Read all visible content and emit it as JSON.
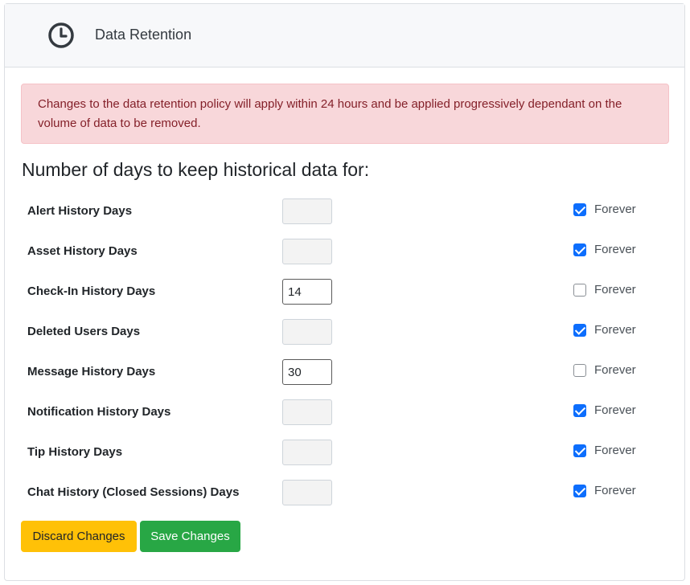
{
  "header": {
    "icon": "clock-icon",
    "title": "Data Retention"
  },
  "alert": {
    "text": "Changes to the data retention policy will apply within 24 hours and be applied progressively dependant on the volume of data to be removed."
  },
  "section": {
    "heading": "Number of days to keep historical data for:"
  },
  "settings": [
    {
      "label": "Alert History Days",
      "value": "",
      "forever": true,
      "forever_label": "Forever"
    },
    {
      "label": "Asset History Days",
      "value": "",
      "forever": true,
      "forever_label": "Forever"
    },
    {
      "label": "Check-In History Days",
      "value": "14",
      "forever": false,
      "forever_label": "Forever"
    },
    {
      "label": "Deleted Users Days",
      "value": "",
      "forever": true,
      "forever_label": "Forever"
    },
    {
      "label": "Message History Days",
      "value": "30",
      "forever": false,
      "forever_label": "Forever"
    },
    {
      "label": "Notification History Days",
      "value": "",
      "forever": true,
      "forever_label": "Forever"
    },
    {
      "label": "Tip History Days",
      "value": "",
      "forever": true,
      "forever_label": "Forever"
    },
    {
      "label": "Chat History (Closed Sessions) Days",
      "value": "",
      "forever": true,
      "forever_label": "Forever"
    }
  ],
  "actions": {
    "discard_label": "Discard Changes",
    "save_label": "Save Changes"
  },
  "colors": {
    "discard": "#ffc107",
    "save": "#28a745",
    "checkbox_checked": "#0d6efd",
    "alert_bg": "#f8d7da",
    "alert_text": "#842029"
  }
}
